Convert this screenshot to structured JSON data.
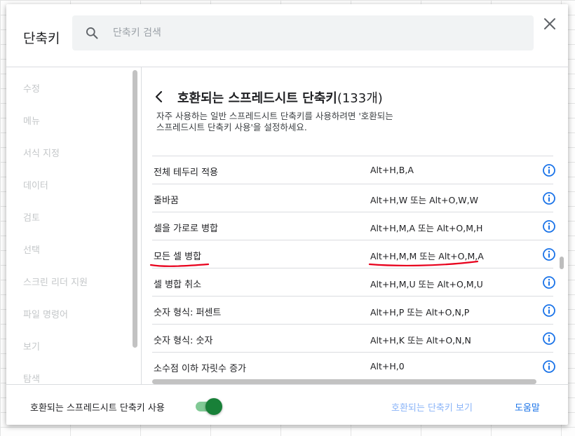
{
  "dialog": {
    "title": "단축키",
    "search_placeholder": "단축키 검색",
    "close_icon": "close-icon"
  },
  "sidebar": {
    "items": [
      {
        "label": "수정"
      },
      {
        "label": "메뉴"
      },
      {
        "label": "서식 지정"
      },
      {
        "label": "데이터"
      },
      {
        "label": "검토"
      },
      {
        "label": "선택"
      },
      {
        "label": "스크린 리더 지원"
      },
      {
        "label": "파일 명령어"
      },
      {
        "label": "보기"
      },
      {
        "label": "탐색"
      }
    ]
  },
  "section": {
    "title": "호환되는 스프레드시트 단축키",
    "count": "(133개)",
    "desc_line1": "자주 사용하는 일반 스프레드시트 단축키를 사용하려면 '호환되는",
    "desc_line2": "스프레드시트 단축키 사용'을 설정하세요."
  },
  "shortcuts": [
    {
      "name": "전체 테두리 적용",
      "keys": "Alt+H,B,A"
    },
    {
      "name": "줄바꿈",
      "keys": "Alt+H,W 또는 Alt+O,W,W"
    },
    {
      "name": "셀을 가로로 병합",
      "keys": "Alt+H,M,A 또는 Alt+O,M,H"
    },
    {
      "name": "모든 셀 병합",
      "keys": "Alt+H,M,M 또는 Alt+O,M,A"
    },
    {
      "name": "셀 병합 취소",
      "keys": "Alt+H,M,U 또는 Alt+O,M,U"
    },
    {
      "name": "숫자 형식: 퍼센트",
      "keys": "Alt+H,P 또는 Alt+O,N,P"
    },
    {
      "name": "숫자 형식: 숫자",
      "keys": "Alt+H,K 또는 Alt+O,N,N"
    },
    {
      "name": "소수점 이하 자릿수 증가",
      "keys": "Alt+H,0"
    }
  ],
  "footer": {
    "toggle_label": "호환되는 스프레드시트 단축키 사용",
    "toggle_on": true,
    "view_link": "호환되는 단축키 보기",
    "help_link": "도움말"
  },
  "colors": {
    "accent": "#1a73e8",
    "toggle_on": "#188038",
    "annotation": "#e8001c"
  }
}
